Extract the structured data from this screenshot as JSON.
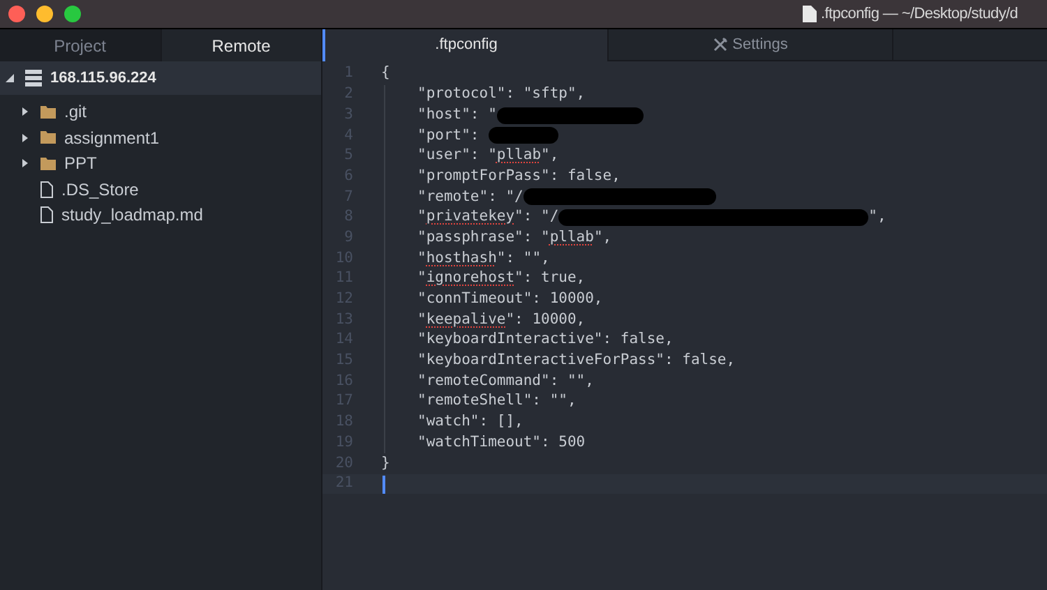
{
  "window": {
    "title": ".ftpconfig — ~/Desktop/study/d"
  },
  "sidebar": {
    "tabs": [
      {
        "label": "Project",
        "selected": false
      },
      {
        "label": "Remote",
        "selected": true
      }
    ],
    "tree": [
      {
        "label": "168.115.96.224",
        "kind": "server",
        "expanded": true,
        "selected": true,
        "children": [
          {
            "label": ".git",
            "kind": "folder",
            "expanded": false
          },
          {
            "label": "assignment1",
            "kind": "folder",
            "expanded": false
          },
          {
            "label": "PPT",
            "kind": "folder",
            "expanded": false
          },
          {
            "label": ".DS_Store",
            "kind": "file"
          },
          {
            "label": "study_loadmap.md",
            "kind": "file"
          }
        ]
      }
    ]
  },
  "editor_tabs": [
    {
      "label": ".ftpconfig",
      "kind": "file",
      "selected": true
    },
    {
      "label": "Settings",
      "kind": "settings",
      "selected": false
    }
  ],
  "editor": {
    "lines": [
      {
        "number": "1",
        "kind": "brace",
        "current": false,
        "segments": [
          {
            "text": "{"
          }
        ]
      },
      {
        "number": "2",
        "kind": "member",
        "current": false,
        "segments": [
          {
            "text": "\"protocol\": \"sftp\","
          }
        ]
      },
      {
        "number": "3",
        "kind": "member",
        "current": false,
        "segments": [
          {
            "text": "\"host\": \""
          },
          {
            "kind": "redaction"
          }
        ]
      },
      {
        "number": "4",
        "kind": "member",
        "current": false,
        "segments": [
          {
            "text": "\"port\": "
          },
          {
            "kind": "redaction"
          }
        ]
      },
      {
        "number": "5",
        "kind": "member",
        "current": false,
        "segments": [
          {
            "text": "\"user\": \""
          },
          {
            "text": "pllab",
            "misspelled": true
          },
          {
            "text": "\","
          }
        ]
      },
      {
        "number": "6",
        "kind": "member",
        "current": false,
        "segments": [
          {
            "text": "\"promptForPass\": false,"
          }
        ]
      },
      {
        "number": "7",
        "kind": "member",
        "current": false,
        "segments": [
          {
            "text": "\"remote\": \"/"
          },
          {
            "kind": "redaction"
          }
        ]
      },
      {
        "number": "8",
        "kind": "member",
        "current": false,
        "segments": [
          {
            "text": "\""
          },
          {
            "text": "privatekey",
            "misspelled": true
          },
          {
            "text": "\": \"/"
          },
          {
            "kind": "redaction"
          },
          {
            "text": "\","
          }
        ]
      },
      {
        "number": "9",
        "kind": "member",
        "current": false,
        "segments": [
          {
            "text": "\"passphrase\": \""
          },
          {
            "text": "pllab",
            "misspelled": true
          },
          {
            "text": "\","
          }
        ]
      },
      {
        "number": "10",
        "kind": "member",
        "current": false,
        "segments": [
          {
            "text": "\""
          },
          {
            "text": "hosthash",
            "misspelled": true
          },
          {
            "text": "\": \"\","
          }
        ]
      },
      {
        "number": "11",
        "kind": "member",
        "current": false,
        "segments": [
          {
            "text": "\""
          },
          {
            "text": "ignorehost",
            "misspelled": true
          },
          {
            "text": "\": true,"
          }
        ]
      },
      {
        "number": "12",
        "kind": "member",
        "current": false,
        "segments": [
          {
            "text": "\"connTimeout\": 10000,"
          }
        ]
      },
      {
        "number": "13",
        "kind": "member",
        "current": false,
        "segments": [
          {
            "text": "\""
          },
          {
            "text": "keepalive",
            "misspelled": true
          },
          {
            "text": "\": 10000,"
          }
        ]
      },
      {
        "number": "14",
        "kind": "member",
        "current": false,
        "segments": [
          {
            "text": "\"keyboardInteractive\": false,"
          }
        ]
      },
      {
        "number": "15",
        "kind": "member",
        "current": false,
        "segments": [
          {
            "text": "\"keyboardInteractiveForPass\": false,"
          }
        ]
      },
      {
        "number": "16",
        "kind": "member",
        "current": false,
        "segments": [
          {
            "text": "\"remoteCommand\": \"\","
          }
        ]
      },
      {
        "number": "17",
        "kind": "member",
        "current": false,
        "segments": [
          {
            "text": "\"remoteShell\": \"\","
          }
        ]
      },
      {
        "number": "18",
        "kind": "member",
        "current": false,
        "segments": [
          {
            "text": "\"watch\": [],"
          }
        ]
      },
      {
        "number": "19",
        "kind": "member",
        "current": false,
        "segments": [
          {
            "text": "\"watchTimeout\": 500"
          }
        ]
      },
      {
        "number": "20",
        "kind": "brace",
        "current": false,
        "segments": [
          {
            "text": "}"
          }
        ]
      },
      {
        "number": "21",
        "kind": "blank",
        "current": true
      }
    ]
  }
}
